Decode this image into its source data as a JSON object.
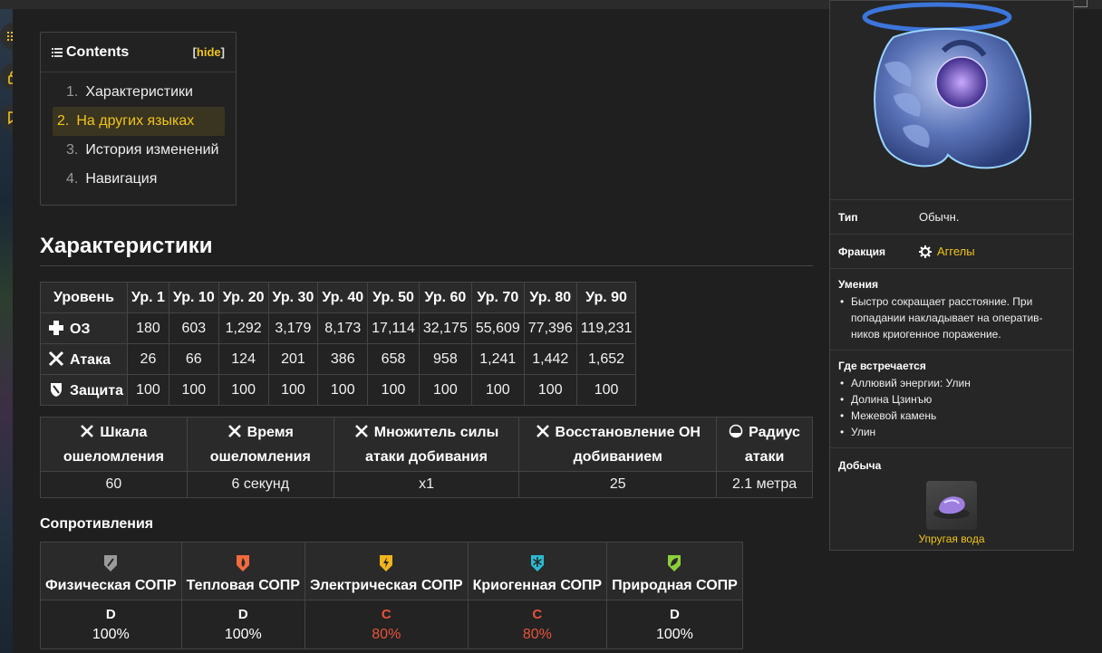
{
  "toc": {
    "title": "Contents",
    "hide_open": "[",
    "hide_label": "hide",
    "hide_close": "]",
    "items": [
      {
        "num": "1.",
        "label": "Характеристики"
      },
      {
        "num": "2.",
        "label": "На других языках"
      },
      {
        "num": "3.",
        "label": "История изменений"
      },
      {
        "num": "4.",
        "label": "Навигация"
      }
    ]
  },
  "section_title": "Характеристики",
  "stats": {
    "headers": [
      "Уровень",
      "Ур. 1",
      "Ур. 10",
      "Ур. 20",
      "Ур. 30",
      "Ур. 40",
      "Ур. 50",
      "Ур. 60",
      "Ур. 70",
      "Ур. 80",
      "Ур. 90"
    ],
    "rows": [
      {
        "icon": "plus-icon",
        "label": "ОЗ",
        "values": [
          "180",
          "603",
          "1,292",
          "3,179",
          "8,173",
          "17,114",
          "32,175",
          "55,609",
          "77,396",
          "119,231"
        ]
      },
      {
        "icon": "crossed-swords-icon",
        "label": "Атака",
        "values": [
          "26",
          "66",
          "124",
          "201",
          "386",
          "658",
          "958",
          "1,241",
          "1,442",
          "1,652"
        ]
      },
      {
        "icon": "shield-icon",
        "label": "Защита",
        "values": [
          "100",
          "100",
          "100",
          "100",
          "100",
          "100",
          "100",
          "100",
          "100",
          "100"
        ]
      }
    ]
  },
  "stun": {
    "headers": [
      {
        "line1": "Шкала",
        "line2": "ошеломления"
      },
      {
        "line1": "Время",
        "line2": "ошеломления"
      },
      {
        "line1": "Множитель силы",
        "line2": "атаки добивания"
      },
      {
        "line1": "Восстановление ОН",
        "line2": "добиванием"
      },
      {
        "line1": "Радиус",
        "line2": "атаки"
      }
    ],
    "values": [
      "60",
      "6 секунд",
      "x1",
      "25",
      "2.1 метра"
    ]
  },
  "resistances": {
    "title": "Сопротивления",
    "items": [
      {
        "label": "Физическая СОПР",
        "grade": "D",
        "percent": "100%",
        "icon": "physical-icon",
        "color": "#9a9a9a",
        "value_color": "#ffffff"
      },
      {
        "label": "Тепловая СОПР",
        "grade": "D",
        "percent": "100%",
        "icon": "heat-icon",
        "color": "#f26a3d",
        "value_color": "#ffffff"
      },
      {
        "label": "Электрическая СОПР",
        "grade": "C",
        "percent": "80%",
        "icon": "electric-icon",
        "color": "#f0b41e",
        "value_color": "#e8523a"
      },
      {
        "label": "Криогенная СОПР",
        "grade": "C",
        "percent": "80%",
        "icon": "cryo-icon",
        "color": "#2bbcd2",
        "value_color": "#e8523a"
      },
      {
        "label": "Природная СОПР",
        "grade": "D",
        "percent": "100%",
        "icon": "nature-icon",
        "color": "#8ccf3c",
        "value_color": "#ffffff"
      }
    ]
  },
  "infobox": {
    "type_label": "Тип",
    "type_value": "Обычн.",
    "faction_label": "Фракция",
    "faction_value": "Аггелы",
    "skills_title": "Умения",
    "skills": [
      "Быстро сокращает расстояние. При попадании накладывает на оператив-ников криогенное поражение."
    ],
    "locations_title": "Где встречается",
    "locations": [
      "Аллювий энергии: Улин",
      "Долина Цзинъю",
      "Межевой камень",
      "Улин"
    ],
    "loot_title": "Добыча",
    "loot_item": "Упругая вода"
  }
}
